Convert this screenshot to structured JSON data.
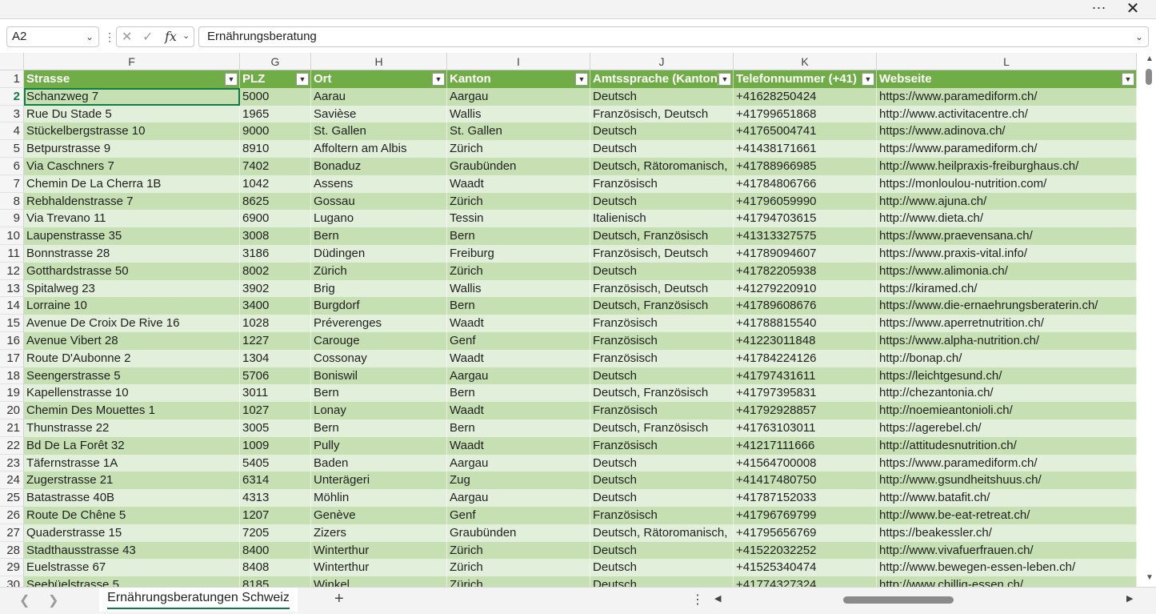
{
  "titlebar": {
    "more_icon": "⋯",
    "close_icon": "✕"
  },
  "formula_bar": {
    "name_box": "A2",
    "formula": "Ernährungsberatung",
    "fx_label": "fx"
  },
  "columns": [
    {
      "letter": "F",
      "header": "Strasse"
    },
    {
      "letter": "G",
      "header": "PLZ"
    },
    {
      "letter": "H",
      "header": "Ort"
    },
    {
      "letter": "I",
      "header": "Kanton"
    },
    {
      "letter": "J",
      "header": "Amtssprache (Kanton)"
    },
    {
      "letter": "K",
      "header": "Telefonnummer (+41)"
    },
    {
      "letter": "L",
      "header": "Webseite"
    }
  ],
  "rows": [
    {
      "n": "2",
      "c": [
        "Schanzweg 7",
        "5000",
        "Aarau",
        "Aargau",
        "Deutsch",
        "+41628250424",
        "https://www.paramediform.ch/"
      ]
    },
    {
      "n": "3",
      "c": [
        "Rue Du Stade 5",
        "1965",
        "Savièse",
        "Wallis",
        "Französisch, Deutsch",
        "+41799651868",
        "http://www.activitacentre.ch/"
      ]
    },
    {
      "n": "4",
      "c": [
        "Stückelbergstrasse 10",
        "9000",
        "St. Gallen",
        "St. Gallen",
        "Deutsch",
        "+41765004741",
        "https://www.adinova.ch/"
      ]
    },
    {
      "n": "5",
      "c": [
        "Betpurstrasse 9",
        "8910",
        "Affoltern am Albis",
        "Zürich",
        "Deutsch",
        "+41438171661",
        "https://www.paramediform.ch/"
      ]
    },
    {
      "n": "6",
      "c": [
        "Via Caschners 7",
        "7402",
        "Bonaduz",
        "Graubünden",
        "Deutsch, Rätoromanisch,",
        "+41788966985",
        "http://www.heilpraxis-freiburghaus.ch/"
      ]
    },
    {
      "n": "7",
      "c": [
        "Chemin De La Cherra 1B",
        "1042",
        "Assens",
        "Waadt",
        "Französisch",
        "+41784806766",
        "https://monloulou-nutrition.com/"
      ]
    },
    {
      "n": "8",
      "c": [
        "Rebhaldenstrasse 7",
        "8625",
        "Gossau",
        "Zürich",
        "Deutsch",
        "+41796059990",
        "http://www.ajuna.ch/"
      ]
    },
    {
      "n": "9",
      "c": [
        "Via Trevano 11",
        "6900",
        "Lugano",
        "Tessin",
        "Italienisch",
        "+41794703615",
        "http://www.dieta.ch/"
      ]
    },
    {
      "n": "10",
      "c": [
        "Laupenstrasse 35",
        "3008",
        "Bern",
        "Bern",
        "Deutsch, Französisch",
        "+41313327575",
        "https://www.praevensana.ch/"
      ]
    },
    {
      "n": "11",
      "c": [
        "Bonnstrasse 28",
        "3186",
        "Düdingen",
        "Freiburg",
        "Französisch, Deutsch",
        "+41789094607",
        "https://www.praxis-vital.info/"
      ]
    },
    {
      "n": "12",
      "c": [
        "Gotthardstrasse 50",
        "8002",
        "Zürich",
        "Zürich",
        "Deutsch",
        "+41782205938",
        "https://www.alimonia.ch/"
      ]
    },
    {
      "n": "13",
      "c": [
        "Spitalweg 23",
        "3902",
        "Brig",
        "Wallis",
        "Französisch, Deutsch",
        "+41279220910",
        "https://kiramed.ch/"
      ]
    },
    {
      "n": "14",
      "c": [
        "Lorraine 10",
        "3400",
        "Burgdorf",
        "Bern",
        "Deutsch, Französisch",
        "+41789608676",
        "https://www.die-ernaehrungsberaterin.ch/"
      ]
    },
    {
      "n": "15",
      "c": [
        "Avenue De Croix De Rive 16",
        "1028",
        "Préverenges",
        "Waadt",
        "Französisch",
        "+41788815540",
        "https://www.aperretnutrition.ch/"
      ]
    },
    {
      "n": "16",
      "c": [
        "Avenue Vibert 28",
        "1227",
        "Carouge",
        "Genf",
        "Französisch",
        "+41223011848",
        "https://www.alpha-nutrition.ch/"
      ]
    },
    {
      "n": "17",
      "c": [
        "Route D'Aubonne 2",
        "1304",
        "Cossonay",
        "Waadt",
        "Französisch",
        "+41784224126",
        "http://bonap.ch/"
      ]
    },
    {
      "n": "18",
      "c": [
        "Seengerstrasse 5",
        "5706",
        "Boniswil",
        "Aargau",
        "Deutsch",
        "+41797431611",
        "https://leichtgesund.ch/"
      ]
    },
    {
      "n": "19",
      "c": [
        "Kapellenstrasse 10",
        "3011",
        "Bern",
        "Bern",
        "Deutsch, Französisch",
        "+41797395831",
        "http://chezantonia.ch/"
      ]
    },
    {
      "n": "20",
      "c": [
        "Chemin Des Mouettes 1",
        "1027",
        "Lonay",
        "Waadt",
        "Französisch",
        "+41792928857",
        "http://noemieantonioli.ch/"
      ]
    },
    {
      "n": "21",
      "c": [
        "Thunstrasse 22",
        "3005",
        "Bern",
        "Bern",
        "Deutsch, Französisch",
        "+41763103011",
        "https://agerebel.ch/"
      ]
    },
    {
      "n": "22",
      "c": [
        "Bd De La Forêt 32",
        "1009",
        "Pully",
        "Waadt",
        "Französisch",
        "+41217111666",
        "http://attitudesnutrition.ch/"
      ]
    },
    {
      "n": "23",
      "c": [
        "Täfernstrasse 1A",
        "5405",
        "Baden",
        "Aargau",
        "Deutsch",
        "+41564700008",
        "https://www.paramediform.ch/"
      ]
    },
    {
      "n": "24",
      "c": [
        "Zugerstrasse 21",
        "6314",
        "Unterägeri",
        "Zug",
        "Deutsch",
        "+41417480750",
        "http://www.gsundheitshuus.ch/"
      ]
    },
    {
      "n": "25",
      "c": [
        "Batastrasse 40B",
        "4313",
        "Möhlin",
        "Aargau",
        "Deutsch",
        "+41787152033",
        "http://www.batafit.ch/"
      ]
    },
    {
      "n": "26",
      "c": [
        "Route De Chêne 5",
        "1207",
        "Genève",
        "Genf",
        "Französisch",
        "+41796769799",
        "http://www.be-eat-retreat.ch/"
      ]
    },
    {
      "n": "27",
      "c": [
        "Quaderstrasse 15",
        "7205",
        "Zizers",
        "Graubünden",
        "Deutsch, Rätoromanisch,",
        "+41795656769",
        "https://beakessler.ch/"
      ]
    },
    {
      "n": "28",
      "c": [
        "Stadthausstrasse 43",
        "8400",
        "Winterthur",
        "Zürich",
        "Deutsch",
        "+41522032252",
        "http://www.vivafuerfrauen.ch/"
      ]
    },
    {
      "n": "29",
      "c": [
        "Euelstrasse 67",
        "8408",
        "Winterthur",
        "Zürich",
        "Deutsch",
        "+41525340474",
        "http://www.bewegen-essen-leben.ch/"
      ]
    },
    {
      "n": "30",
      "c": [
        "Seebüelstrasse 5",
        "8185",
        "Winkel",
        "Zürich",
        "Deutsch",
        "+41774327324",
        "http://www.chillig-essen.ch/"
      ]
    }
  ],
  "sheet_tab": "Ernährungsberatungen Schweiz",
  "colors": {
    "header_green": "#70ad47",
    "band_dark": "#c6e0b4",
    "band_light": "#e2efda",
    "accent": "#107c41"
  }
}
